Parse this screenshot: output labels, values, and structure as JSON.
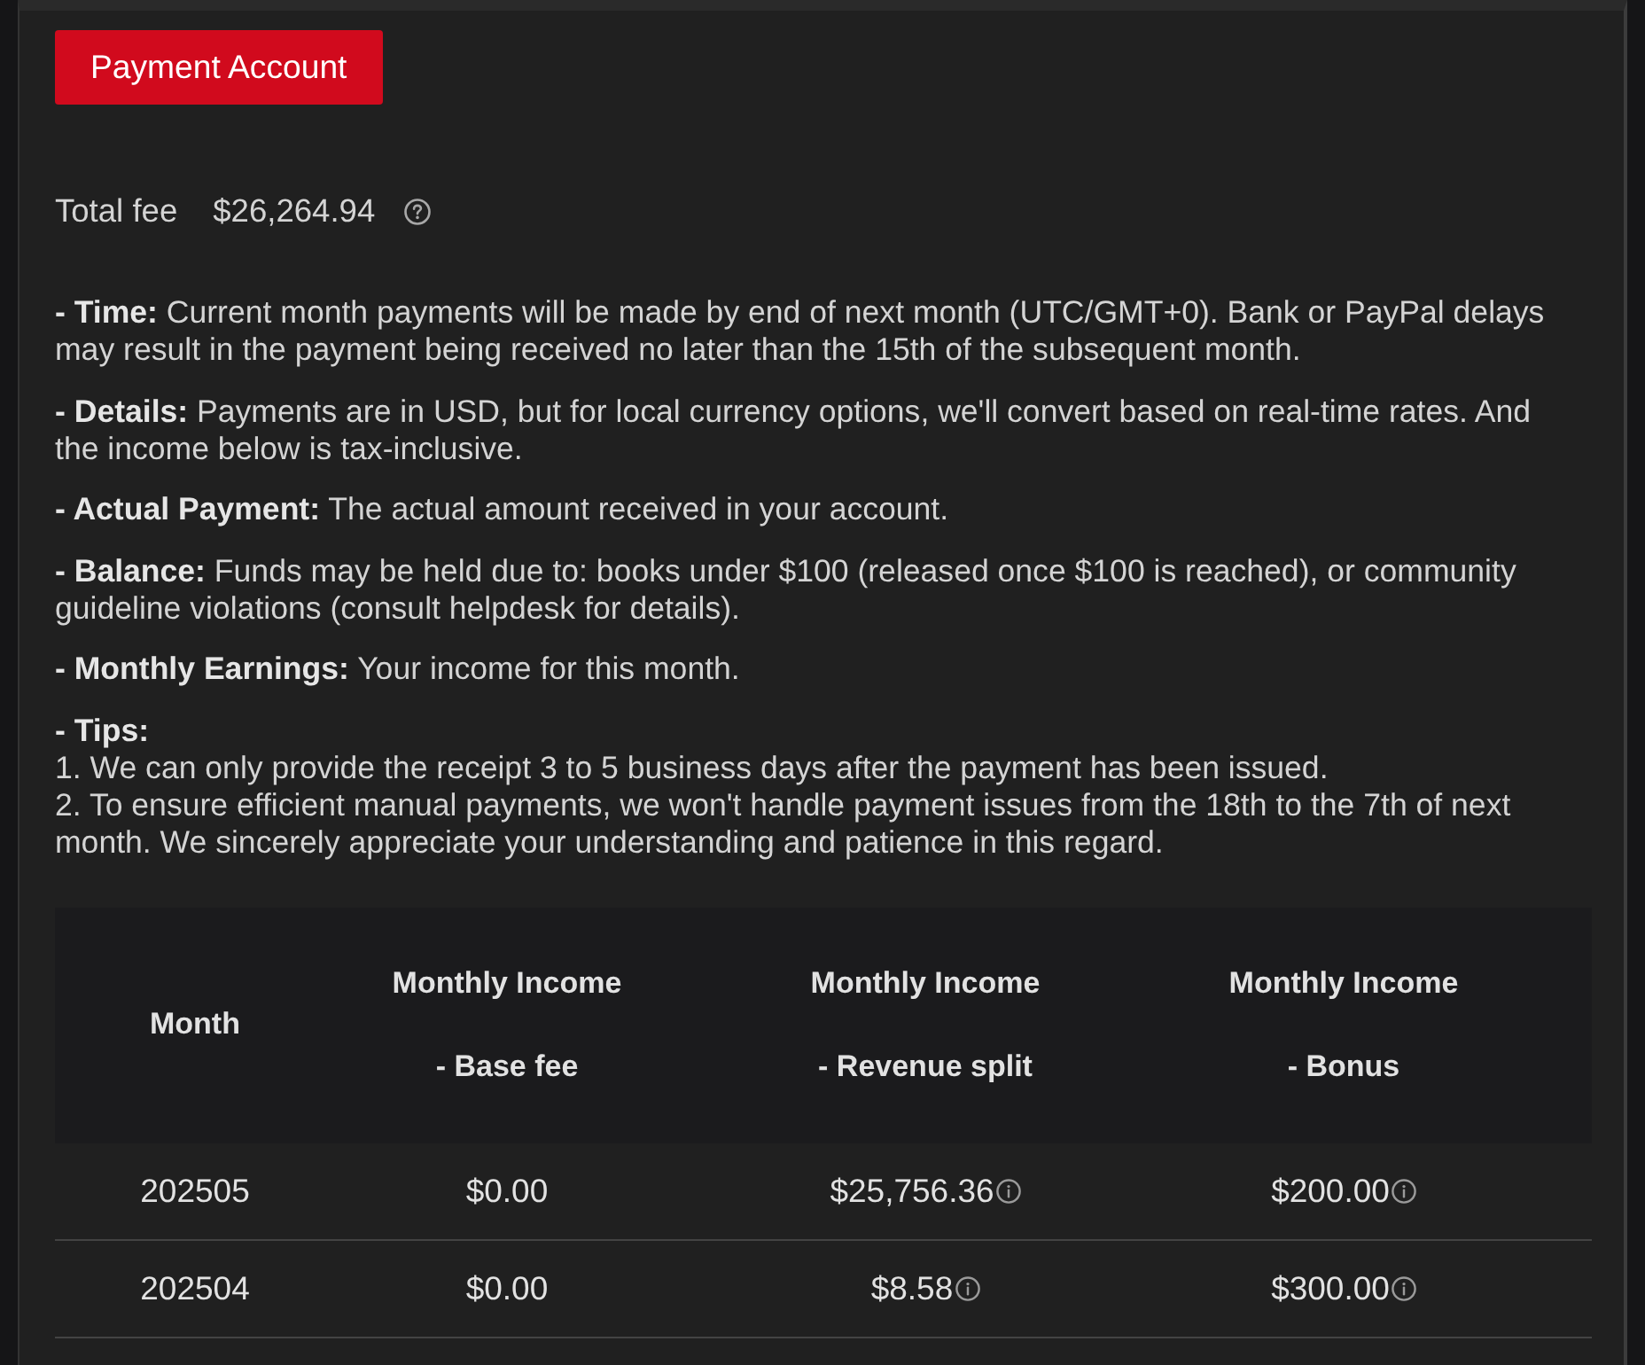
{
  "button": {
    "label": "Payment Account"
  },
  "total_fee": {
    "label": "Total fee",
    "value": "$26,264.94"
  },
  "notes": [
    {
      "kind": "paragraph",
      "text": "**- Time:** Current month payments will be made by end of next month (UTC/GMT+0). Bank or PayPal delays may result in the payment being received no later than the 15th of the subsequent month."
    },
    {
      "kind": "paragraph",
      "text": "**- Details:** Payments are in USD, but for local currency options, we'll convert based on real-time rates. And the income below is tax-inclusive."
    },
    {
      "kind": "paragraph",
      "text": "**- Actual Payment:** The actual amount received in your account."
    },
    {
      "kind": "paragraph",
      "text": "**- Balance:** Funds may be held due to: books under $100 (released once $100 is reached), or community guideline violations (consult helpdesk for details)."
    },
    {
      "kind": "paragraph",
      "text": "**- Monthly Earnings:** Your income for this month."
    },
    {
      "kind": "list",
      "title": "- Tips:",
      "items": [
        "1. We can only provide the receipt 3 to 5 business days after the payment has been issued.",
        "2. To ensure efficient manual payments, we won't handle payment issues from the 18th to the 7th of next month. We sincerely appreciate your understanding and patience in this regard."
      ]
    }
  ],
  "table": {
    "columns": [
      {
        "title": "Month"
      },
      {
        "title": "Monthly Income",
        "subtitle": "- Base fee"
      },
      {
        "title": "Monthly Income",
        "subtitle": "- Revenue split"
      },
      {
        "title": "Monthly Income",
        "subtitle": "- Bonus"
      }
    ],
    "rows": [
      {
        "cells": [
          {
            "text": "202505",
            "info": false
          },
          {
            "text": "$0.00",
            "info": false
          },
          {
            "text": "$25,756.36",
            "info": true
          },
          {
            "text": "$200.00",
            "info": true
          }
        ]
      },
      {
        "cells": [
          {
            "text": "202504",
            "info": false
          },
          {
            "text": "$0.00",
            "info": false
          },
          {
            "text": "$8.58",
            "info": true
          },
          {
            "text": "$300.00",
            "info": true
          }
        ]
      }
    ]
  }
}
